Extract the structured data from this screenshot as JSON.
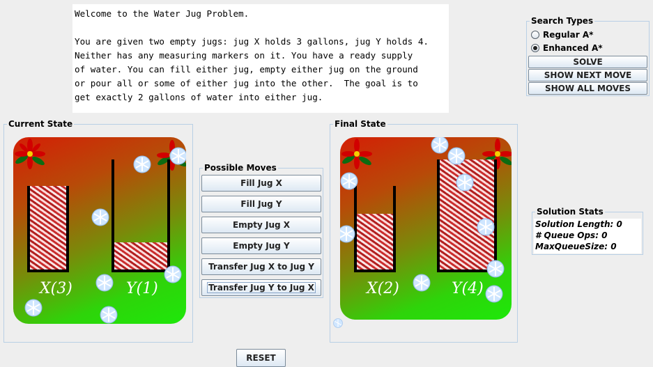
{
  "intro": {
    "lines": [
      "Welcome to the Water Jug Problem.",
      "",
      "You are given two empty jugs: jug X holds 3 gallons, jug Y holds 4.",
      "Neither has any measuring markers on it. You have a ready supply",
      "of water. You can fill either jug, empty either jug on the ground",
      "or pour all or some of either jug into the other.  The goal is to",
      "get exactly 2 gallons of water into either jug."
    ]
  },
  "search": {
    "title": "Search Types",
    "options": [
      {
        "label": "Regular A*",
        "selected": false
      },
      {
        "label": "Enhanced A*",
        "selected": true
      }
    ],
    "solve_label": "SOLVE",
    "next_label": "SHOW NEXT MOVE",
    "all_label": "SHOW ALL MOVES"
  },
  "current_state": {
    "title": "Current State",
    "jug_x": {
      "label": "X(3)",
      "fill": 1.0
    },
    "jug_y": {
      "label": "Y(1)",
      "fill": 0.25
    }
  },
  "final_state": {
    "title": "Final State",
    "jug_x": {
      "label": "X(2)",
      "fill": 0.67
    },
    "jug_y": {
      "label": "Y(4)",
      "fill": 1.0
    }
  },
  "moves": {
    "title": "Possible Moves",
    "items": [
      "Fill Jug X",
      "Fill Jug Y",
      "Empty Jug X",
      "Empty Jug Y",
      "Transfer Jug X to Jug Y",
      "Transfer Jug Y to Jug X"
    ]
  },
  "stats": {
    "title": "Solution Stats",
    "solution_length": "Solution Length: 0",
    "queue_ops": "# Queue Ops: 0",
    "max_queue": "MaxQueueSize: 0"
  },
  "reset_label": "RESET",
  "colors": {
    "panel_bg": "#eeeeee",
    "border": "#b8cfe5",
    "scene_top": "#d41f06",
    "scene_bottom": "#1ee80a",
    "label_text": "#ffffff"
  },
  "icons": [
    "snowflake-icon",
    "poinsettia-icon"
  ]
}
